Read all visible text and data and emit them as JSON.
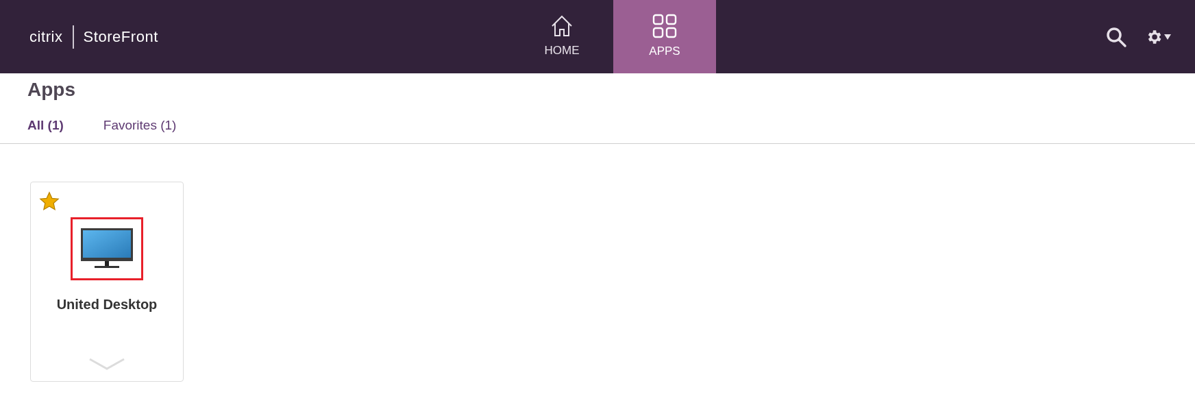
{
  "header": {
    "brand": "citrix",
    "product": "StoreFront",
    "nav": [
      {
        "label": "HOME",
        "kind": "home",
        "selected": false
      },
      {
        "label": "APPS",
        "kind": "apps",
        "selected": true
      }
    ]
  },
  "page": {
    "title": "Apps",
    "tabs": [
      {
        "label": "All (1)",
        "selected": true
      },
      {
        "label": "Favorites (1)",
        "selected": false
      }
    ]
  },
  "apps": [
    {
      "name": "United Desktop",
      "favorite": true,
      "selected": true
    }
  ]
}
